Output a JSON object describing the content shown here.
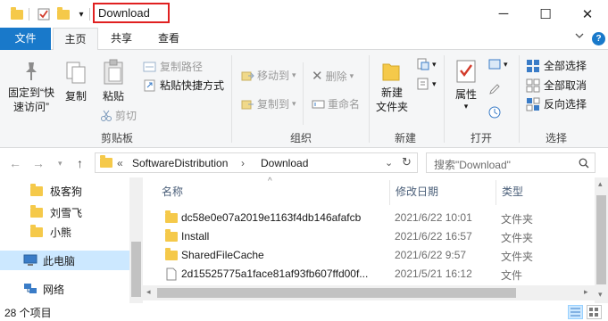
{
  "window": {
    "title": "Download",
    "minimize_glyph": "─",
    "maximize_glyph": "☐",
    "close_glyph": "✕",
    "highlight_color": "#e02020"
  },
  "quick_access_toolbar": {
    "dropdown_glyph": "▾"
  },
  "tabs": [
    {
      "label": "文件"
    },
    {
      "label": "主页"
    },
    {
      "label": "共享"
    },
    {
      "label": "查看"
    }
  ],
  "ribbon": {
    "clipboard": {
      "pin_label_line1": "固定到“快",
      "pin_label_line2": "速访问”",
      "copy": "复制",
      "paste": "粘贴",
      "copy_path": "复制路径",
      "paste_shortcut": "粘贴快捷方式",
      "cut": "剪切",
      "group": "剪贴板"
    },
    "organize": {
      "move_to": "移动到",
      "copy_to": "复制到",
      "delete": "删除",
      "rename": "重命名",
      "group": "组织"
    },
    "new": {
      "new_folder_line1": "新建",
      "new_folder_line2": "文件夹",
      "group": "新建"
    },
    "open": {
      "properties": "属性",
      "group": "打开"
    },
    "select": {
      "select_all": "全部选择",
      "select_none": "全部取消",
      "invert": "反向选择",
      "group": "选择"
    }
  },
  "address": {
    "overflow": "«",
    "crumbs": [
      "SoftwareDistribution",
      "Download"
    ],
    "separator": "›",
    "search_placeholder": "搜索\"Download\""
  },
  "navpane": {
    "items": [
      {
        "label": "极客狗",
        "icon": "folder-icon"
      },
      {
        "label": "刘雪飞",
        "icon": "folder-icon"
      },
      {
        "label": "小熊",
        "icon": "folder-icon"
      },
      {
        "label": "此电脑",
        "icon": "computer-icon",
        "selected": true
      },
      {
        "label": "网络",
        "icon": "network-icon"
      }
    ]
  },
  "file_list": {
    "columns": {
      "name": "名称",
      "date": "修改日期",
      "type": "类型"
    },
    "rows": [
      {
        "name": "dc58e0e07a2019e1163f4db146afafcb",
        "date": "2021/6/22 10:01",
        "type": "文件夹",
        "icon": "folder-icon"
      },
      {
        "name": "Install",
        "date": "2021/6/22 16:57",
        "type": "文件夹",
        "icon": "folder-icon"
      },
      {
        "name": "SharedFileCache",
        "date": "2021/6/22 9:57",
        "type": "文件夹",
        "icon": "folder-icon"
      },
      {
        "name": "2d15525775a1face81af93fb607ffd00f...",
        "date": "2021/5/21 16:12",
        "type": "文件",
        "icon": "file-icon"
      }
    ]
  },
  "status": {
    "count": "28 个项目"
  },
  "colors": {
    "accent": "#1979ca",
    "folder": "#f5c94a",
    "selection": "#cce8ff"
  }
}
